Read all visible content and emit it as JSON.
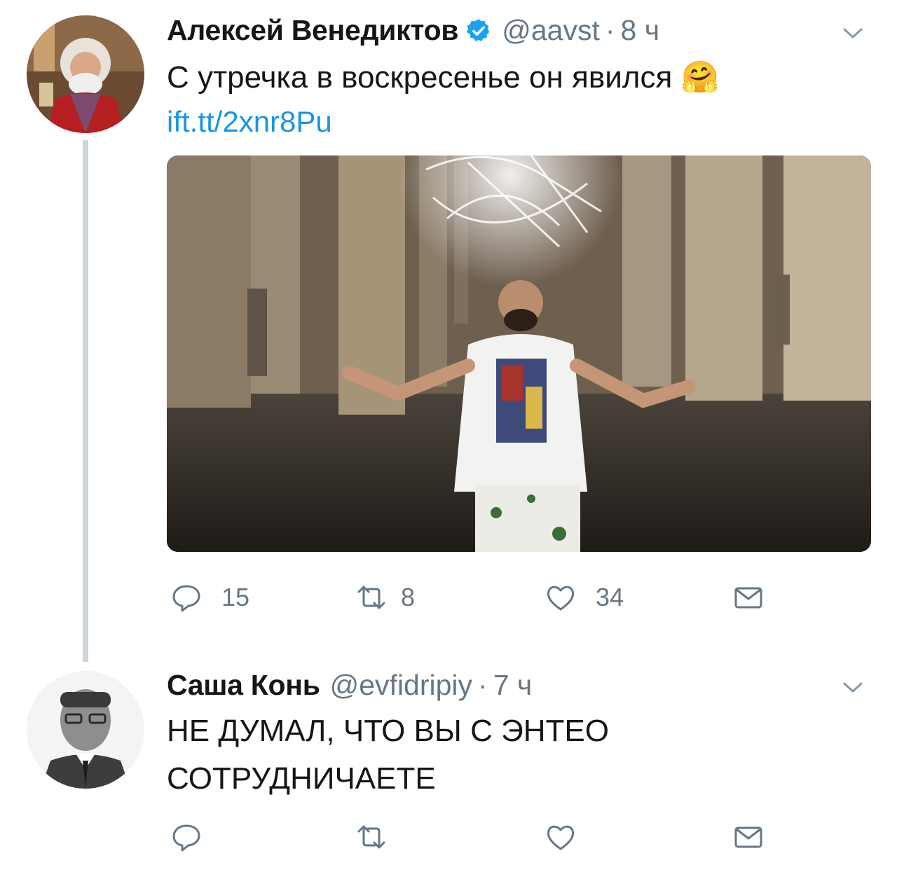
{
  "tweet1": {
    "author_name": "Алексей Венедиктов",
    "handle": "@aavst",
    "separator": "·",
    "time": "8 ч",
    "text": "С утречка в воскресенье он явился",
    "emoji": "🤗",
    "link": "ift.tt/2xnr8Pu",
    "actions": {
      "reply_count": "15",
      "retweet_count": "8",
      "like_count": "34"
    },
    "icons": [
      "verified-badge-icon",
      "chevron-down-icon",
      "reply-icon",
      "retweet-icon",
      "like-icon",
      "dm-icon"
    ]
  },
  "tweet2": {
    "author_name": "Саша Конь",
    "handle": "@evfidripiy",
    "separator": "·",
    "time": "7 ч",
    "text": "НЕ ДУМАЛ, ЧТО ВЫ С ЭНТЕО СОТРУДНИЧАЕТЕ",
    "icons": [
      "chevron-down-icon",
      "reply-icon",
      "retweet-icon",
      "like-icon",
      "dm-icon"
    ]
  },
  "colors": {
    "link": "#1b95e0",
    "secondary_text": "#657786",
    "thread_line": "#ccd6dd",
    "verified": "#1da1f2"
  }
}
